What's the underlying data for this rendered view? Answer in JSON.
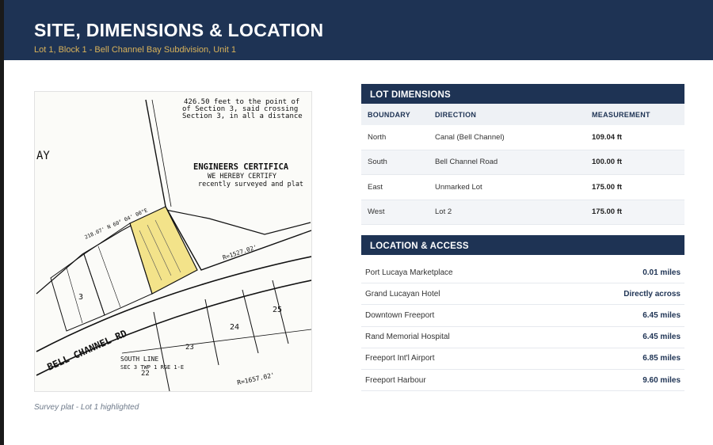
{
  "header": {
    "title": "SITE, DIMENSIONS & LOCATION",
    "subtitle": "Lot 1, Block 1 - Bell Channel Bay Subdivision, Unit 1"
  },
  "survey": {
    "caption": "Survey plat - Lot 1 highlighted",
    "highlight_color": "#f3e38a",
    "labels": {
      "desc_line1": "426.50 feet to the point of",
      "desc_line2": "of Section 3, said crossing",
      "desc_line3": "Section 3, in all a distance",
      "engineers_cert": "ENGINEERS CERTIFICA",
      "cert_line1": "WE HEREBY CERTIFY",
      "cert_line2": "recently surveyed and plat",
      "road_name": "BELL CHANNEL RD",
      "south_line": "SOUTH LINE",
      "sec_line": "SEC 3 TWP 1 RGE 1-E",
      "radial_top": "R=1527.02'",
      "radial_bottom": "R=1657.02'",
      "bearing_top": "218.07' N 60° 04' 00\"E",
      "lot_24": "24",
      "lot_25": "25",
      "lot_22": "22",
      "lot_23": "23",
      "lot_3": "3",
      "side_edge": "AY"
    }
  },
  "lot_dimensions": {
    "heading": "LOT DIMENSIONS",
    "columns": [
      "BOUNDARY",
      "DIRECTION",
      "MEASUREMENT"
    ],
    "rows": [
      {
        "boundary": "North",
        "direction": "Canal (Bell Channel)",
        "measurement": "109.04 ft"
      },
      {
        "boundary": "South",
        "direction": "Bell Channel Road",
        "measurement": "100.00 ft"
      },
      {
        "boundary": "East",
        "direction": "Unmarked Lot",
        "measurement": "175.00 ft"
      },
      {
        "boundary": "West",
        "direction": "Lot 2",
        "measurement": "175.00 ft"
      }
    ]
  },
  "location_access": {
    "heading": "LOCATION & ACCESS",
    "items": [
      {
        "name": "Port Lucaya Marketplace",
        "distance": "0.01 miles"
      },
      {
        "name": "Grand Lucayan Hotel",
        "distance": "Directly across"
      },
      {
        "name": "Downtown Freeport",
        "distance": "6.45 miles"
      },
      {
        "name": "Rand Memorial Hospital",
        "distance": "6.45 miles"
      },
      {
        "name": "Freeport Int'l Airport",
        "distance": "6.85 miles"
      },
      {
        "name": "Freeport Harbour",
        "distance": "9.60 miles"
      }
    ]
  },
  "colors": {
    "navy": "#1e3354",
    "gold": "#d9b25a"
  }
}
